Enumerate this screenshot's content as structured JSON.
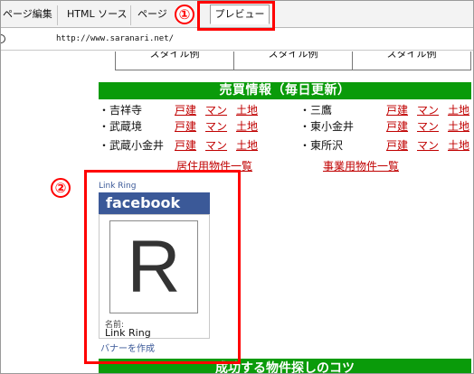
{
  "tabs": [
    {
      "label": "ページ編集"
    },
    {
      "label": "HTML ソース"
    },
    {
      "label": "ページ"
    },
    {
      "label": "プレビュー",
      "active": true
    }
  ],
  "address": {
    "url": "http://www.saranari.net/"
  },
  "style_row": {
    "cells": [
      "スタイル例",
      "スタイル例",
      "スタイル例"
    ]
  },
  "sales": {
    "header": "売買情報（毎日更新）",
    "link_labels": {
      "house": "戸建",
      "mansion": "マン",
      "land": "土地"
    },
    "rows": [
      {
        "left": "・吉祥寺",
        "right": "・三鷹"
      },
      {
        "left": "・武蔵境",
        "right": "・東小金井"
      },
      {
        "left": "・武蔵小金井",
        "right": "・東所沢"
      }
    ],
    "bottom_links": [
      "居住用物件一覧",
      "事業用物件一覧"
    ]
  },
  "facebook_widget": {
    "top_label": "Link Ring",
    "header": "facebook",
    "profile_letter": "R",
    "name_label": "名前:",
    "name_value": "Link Ring",
    "banner_link": "バナーを作成"
  },
  "bottom_bar": {
    "text": "成功する物件探しのコツ"
  },
  "annotations": {
    "num1": "①",
    "num2": "②"
  },
  "colors": {
    "green_bar": "#0a9b0a",
    "link_red": "#c00000",
    "facebook_blue": "#3b5998",
    "annotation_red": "#ff0000"
  }
}
